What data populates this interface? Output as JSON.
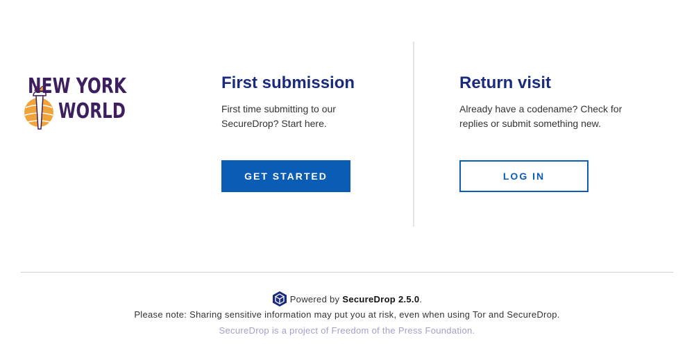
{
  "logo": {
    "line1": "NEW YORK",
    "line2": "WORLD",
    "icon": "statue-of-liberty-torch-globe-logo",
    "colors": {
      "text": "#3d1f5e",
      "globe": "#f0a33a"
    }
  },
  "first_submission": {
    "heading": "First submission",
    "description": "First time submitting to our SecureDrop? Start here.",
    "button_label": "GET STARTED"
  },
  "return_visit": {
    "heading": "Return visit",
    "description": "Already have a codename? Check for replies or submit something new.",
    "button_label": "LOG IN"
  },
  "footer": {
    "powered_prefix": "Powered by",
    "powered_product": "SecureDrop 2.5.0",
    "powered_suffix": ".",
    "powered_icon": "securedrop-cube-icon",
    "note": "Please note: Sharing sensitive information may put you at risk, even when using Tor and SecureDrop.",
    "fpf": "SecureDrop is a project of Freedom of the Press Foundation."
  },
  "colors": {
    "heading": "#1a2b7e",
    "primary_button": "#0b5cb5",
    "fpf_text": "#a3a0c9"
  }
}
